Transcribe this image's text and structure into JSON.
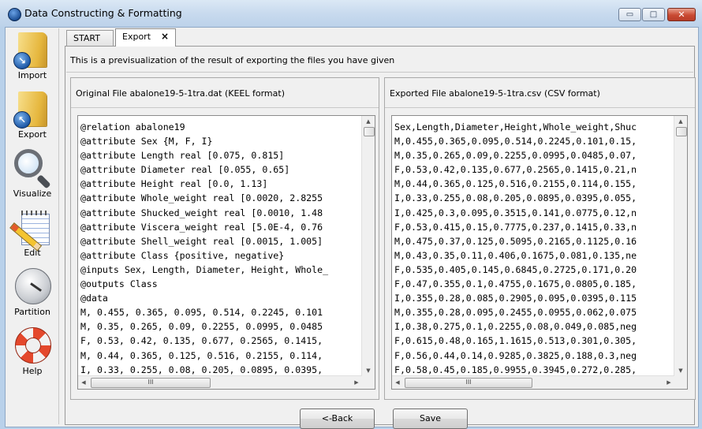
{
  "window": {
    "title": "Data Constructing & Formatting",
    "controls": {
      "minimize": "▭",
      "maximize": "□",
      "close": "✕"
    }
  },
  "sidebar": {
    "items": [
      {
        "label": "Import",
        "icon": "folder-import-icon"
      },
      {
        "label": "Export",
        "icon": "folder-export-icon"
      },
      {
        "label": "Visualize",
        "icon": "magnifier-icon"
      },
      {
        "label": "Edit",
        "icon": "notepad-pencil-icon"
      },
      {
        "label": "Partition",
        "icon": "gauge-icon"
      },
      {
        "label": "Help",
        "icon": "lifebuoy-icon"
      }
    ]
  },
  "tabs": [
    {
      "label": "START"
    },
    {
      "label": "Export",
      "close": "×"
    }
  ],
  "main": {
    "banner": "This is a previsualization of the result of exporting the files you have given",
    "original": {
      "heading": "Original File abalone19-5-1tra.dat (KEEL format)",
      "lines": [
        "@relation abalone19",
        "@attribute Sex {M, F, I}",
        "@attribute Length real [0.075, 0.815]",
        "@attribute Diameter real [0.055, 0.65]",
        "@attribute Height real [0.0, 1.13]",
        "@attribute Whole_weight real [0.0020, 2.8255",
        "@attribute Shucked_weight real [0.0010, 1.48",
        "@attribute Viscera_weight real [5.0E-4, 0.76",
        "@attribute Shell_weight real [0.0015, 1.005]",
        "@attribute Class {positive, negative}",
        "@inputs Sex, Length, Diameter, Height, Whole_",
        "@outputs Class",
        "@data",
        "M, 0.455, 0.365, 0.095, 0.514, 0.2245, 0.101",
        "M, 0.35, 0.265, 0.09, 0.2255, 0.0995, 0.0485",
        "F, 0.53, 0.42, 0.135, 0.677, 0.2565, 0.1415,",
        "M, 0.44, 0.365, 0.125, 0.516, 0.2155, 0.114,",
        "I, 0.33, 0.255, 0.08, 0.205, 0.0895, 0.0395,"
      ]
    },
    "exported": {
      "heading": "Exported File abalone19-5-1tra.csv (CSV format)",
      "lines": [
        "Sex,Length,Diameter,Height,Whole_weight,Shuc",
        "M,0.455,0.365,0.095,0.514,0.2245,0.101,0.15,",
        "M,0.35,0.265,0.09,0.2255,0.0995,0.0485,0.07,",
        "F,0.53,0.42,0.135,0.677,0.2565,0.1415,0.21,n",
        "M,0.44,0.365,0.125,0.516,0.2155,0.114,0.155,",
        "I,0.33,0.255,0.08,0.205,0.0895,0.0395,0.055,",
        "I,0.425,0.3,0.095,0.3515,0.141,0.0775,0.12,n",
        "F,0.53,0.415,0.15,0.7775,0.237,0.1415,0.33,n",
        "M,0.475,0.37,0.125,0.5095,0.2165,0.1125,0.16",
        "M,0.43,0.35,0.11,0.406,0.1675,0.081,0.135,ne",
        "F,0.535,0.405,0.145,0.6845,0.2725,0.171,0.20",
        "F,0.47,0.355,0.1,0.4755,0.1675,0.0805,0.185,",
        "I,0.355,0.28,0.085,0.2905,0.095,0.0395,0.115",
        "M,0.355,0.28,0.095,0.2455,0.0955,0.062,0.075",
        "I,0.38,0.275,0.1,0.2255,0.08,0.049,0.085,neg",
        "F,0.615,0.48,0.165,1.1615,0.513,0.301,0.305,",
        "F,0.56,0.44,0.14,0.9285,0.3825,0.188,0.3,neg",
        "F,0.58,0.45,0.185,0.9955,0.3945,0.272,0.285,"
      ]
    },
    "scroll": {
      "up": "▲",
      "down": "▼",
      "left": "◀",
      "right": "▶",
      "grip": "III"
    }
  },
  "buttons": {
    "back": "<-Back",
    "save": "Save"
  }
}
